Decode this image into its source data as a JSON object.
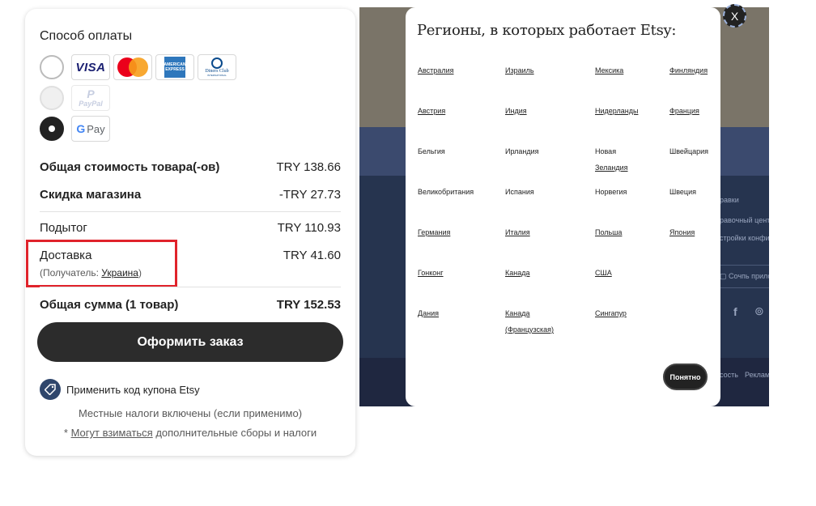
{
  "payment": {
    "title": "Способ оплаты",
    "cards": {
      "visa": "VISA",
      "amex_top": "AMERICAN",
      "amex_bottom": "EXPRESS",
      "diners": "Diners Club",
      "diners_sub": "INTERNATIONAL",
      "paypal": "PayPal",
      "gpay_g": "G",
      "gpay_pay": "Pay"
    }
  },
  "summary": {
    "items_total_label": "Общая стоимость товара(-ов)",
    "items_total_value": "TRY 138.66",
    "discount_label": "Скидка магазина",
    "discount_value": "-TRY 27.73",
    "subtotal_label": "Подытог",
    "subtotal_value": "TRY 110.93",
    "shipping_label": "Доставка",
    "shipping_value": "TRY 41.60",
    "recipient_prefix": "(Получатель: ",
    "recipient_country": "Украина",
    "recipient_suffix": ")",
    "grand_total_label": "Общая сумма (1 товар)",
    "grand_total_value": "TRY 152.53"
  },
  "checkout_button": "Оформить заказ",
  "coupon_label": "Применить код купона Etsy",
  "tax_note": "Местные налоги включены (если применимо)",
  "fees_note": {
    "star": "* ",
    "link": "Могут взиматься",
    "rest": " дополнительные сборы и налоги"
  },
  "background_page": {
    "line1": "равки",
    "line2": "равочный центр",
    "line3": "стройки конфиден",
    "cookie": "Сочпь прило",
    "footer_a": "сость",
    "footer_b": "Реклама на"
  },
  "modal": {
    "title": "Регионы, в которых работает Etsy:",
    "ok_button": "Понятно",
    "close_glyph": "X",
    "columns": [
      [
        {
          "name": "Австралия",
          "link": true
        },
        {
          "name": "Австрия",
          "link": true
        },
        {
          "name": "Бельгия",
          "link": false
        },
        {
          "name": "Великобритания",
          "link": false
        },
        {
          "name": "Германия",
          "link": true
        },
        {
          "name": "Гонконг",
          "link": true
        },
        {
          "name": "Дания",
          "link": true
        }
      ],
      [
        {
          "name": "Израиль",
          "link": true
        },
        {
          "name": "Индия",
          "link": true
        },
        {
          "name": "Ирландия",
          "link": false
        },
        {
          "name": "Испания",
          "link": false
        },
        {
          "name": "Италия",
          "link": true
        },
        {
          "name": "Канада",
          "link": true
        },
        {
          "name": "Канада",
          "name2": "(Французская)",
          "link": true
        }
      ],
      [
        {
          "name": "Мексика",
          "link": true
        },
        {
          "name": "Нидерланды",
          "link": true
        },
        {
          "name": "Новая",
          "name2": "Зеландия",
          "link": false,
          "link2": true
        },
        {
          "name": "Норвегия",
          "link": false
        },
        {
          "name": "Польша",
          "link": true
        },
        {
          "name": "США",
          "link": true
        },
        {
          "name": "Сингапур",
          "link": true
        }
      ],
      [
        {
          "name": "Финляндия",
          "link": true
        },
        {
          "name": "Франция",
          "link": true
        },
        {
          "name": "Швейцария",
          "link": false
        },
        {
          "name": "Швеция",
          "link": false
        },
        {
          "name": "Япония",
          "link": true
        }
      ]
    ]
  }
}
